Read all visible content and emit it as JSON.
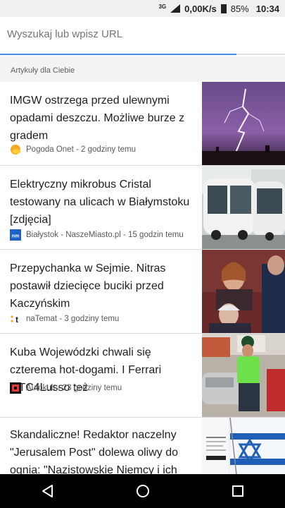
{
  "status_bar": {
    "network_type": "3G",
    "data_rate": "0,00K/s",
    "battery_percent": "85%",
    "time": "10:34"
  },
  "search": {
    "placeholder": "Wyszukaj lub wpisz URL",
    "progress_fraction": 0.83
  },
  "section": {
    "title": "Artykuły dla Ciebie"
  },
  "articles": [
    {
      "title": "IMGW ostrzega przed ulewnymi opadami deszczu. Możliwe burze z gradem",
      "source": "Pogoda Onet - 2 godziny temu",
      "icon": "sun-cloud-icon",
      "image": "lightning-storm"
    },
    {
      "title": "Elektryczny mikrobus Cristal testowany na ulicach w Białymstoku [zdjęcia]",
      "source": "Białystok - NaszeMiasto.pl - 15 godzin temu",
      "icon": "naszemiasto-icon",
      "image": "electric-minibus"
    },
    {
      "title": "Przepychanka w Sejmie. Nitras postawił dziecięce buciki przed Kaczyńskim",
      "source": "naTemat - 3 godziny temu",
      "icon": "natemat-icon",
      "image": "sejm-politicians"
    },
    {
      "title": "Kuba Wojewódzki chwali się czterema hot-dogami. I Ferrari GTC4Lusso też",
      "source": "Autokult - 23 godziny temu",
      "icon": "autokult-icon",
      "image": "man-with-ferrari"
    },
    {
      "title": "Skandaliczne! Redaktor naczelny \"Jerusalem Post\" dolewa oliwy do ognia: \"Nazistowskie Niemcy i ich po…",
      "source": "",
      "icon": "",
      "image": "israel-flag-newspaper"
    }
  ],
  "nav_bar": {
    "buttons": [
      "back",
      "home",
      "recents"
    ]
  }
}
